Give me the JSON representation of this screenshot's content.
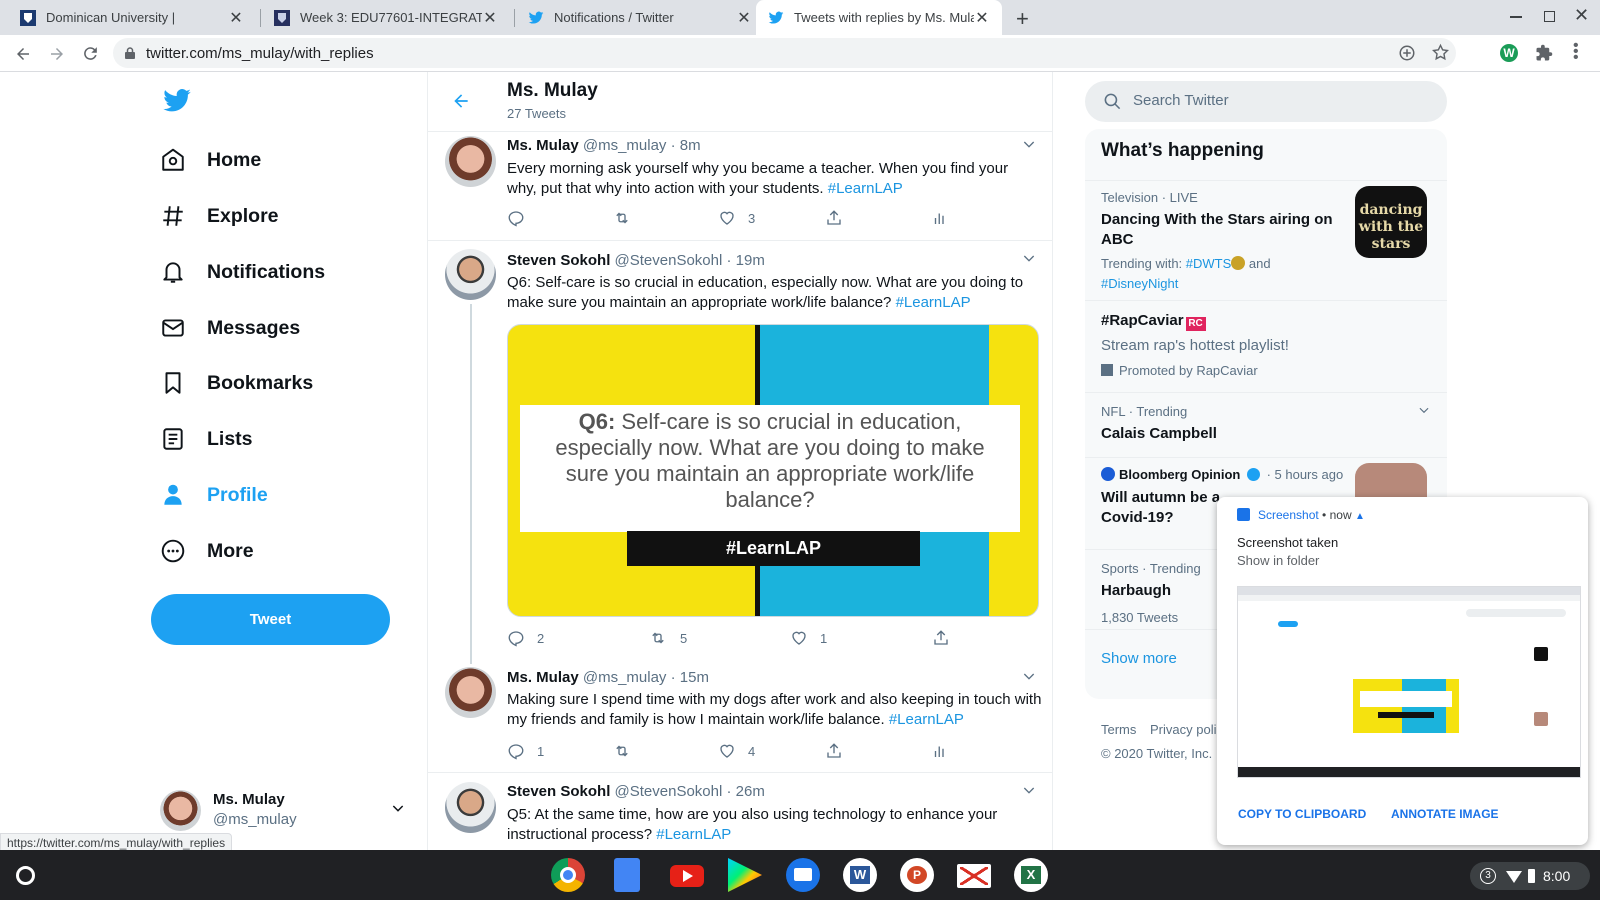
{
  "browser": {
    "tabs": [
      {
        "title": "Dominican University |"
      },
      {
        "title": "Week 3: EDU77601-INTEGRATIN"
      },
      {
        "title": "Notifications / Twitter"
      },
      {
        "title": "Tweets with replies by Ms. Mulay"
      }
    ],
    "url": "twitter.com/ms_mulay/with_replies",
    "status_url": "https://twitter.com/ms_mulay/with_replies"
  },
  "nav": {
    "items": [
      {
        "label": "Home"
      },
      {
        "label": "Explore"
      },
      {
        "label": "Notifications"
      },
      {
        "label": "Messages"
      },
      {
        "label": "Bookmarks"
      },
      {
        "label": "Lists"
      },
      {
        "label": "Profile"
      },
      {
        "label": "More"
      }
    ],
    "tweet_button": "Tweet",
    "account": {
      "name": "Ms. Mulay",
      "handle": "@ms_mulay"
    }
  },
  "header": {
    "title": "Ms. Mulay",
    "subtitle": "27 Tweets"
  },
  "tweets": [
    {
      "name": "Ms. Mulay",
      "handle": "@ms_mulay",
      "time": "· 8m",
      "text": "Every morning ask yourself why you became a teacher. When you find your why, put that why into action with your students.",
      "hashtag": "#LearnLAP",
      "replies": "",
      "retweets": "",
      "likes": "3"
    },
    {
      "name": "Steven Sokohl",
      "handle": "@StevenSokohl",
      "time": "· 19m",
      "text": "Q6: Self-care is so crucial in education, especially now. What are you doing to make sure you maintain an appropriate work/life balance?",
      "hashtag": "#LearnLAP",
      "image": {
        "q_label": "Q6:",
        "q_text": " Self-care is so crucial in education, especially now. What are you doing to make sure you maintain an appropriate work/life balance?",
        "tag": "#LearnLAP"
      },
      "replies": "2",
      "retweets": "5",
      "likes": "1"
    },
    {
      "name": "Ms. Mulay",
      "handle": "@ms_mulay",
      "time": "· 15m",
      "text": "Making sure I spend time with my dogs after work and also keeping in touch with my friends and family is how I maintain work/life balance.",
      "hashtag": "#LearnLAP",
      "replies": "1",
      "retweets": "",
      "likes": "4"
    },
    {
      "name": "Steven Sokohl",
      "handle": "@StevenSokohl",
      "time": "· 26m",
      "text": "Q5: At the same time, how are you also using technology to enhance your instructional process?",
      "hashtag": "#LearnLAP"
    }
  ],
  "sidebar": {
    "search_placeholder": "Search Twitter",
    "trends_title": "What’s happening",
    "trend1": {
      "meta": "Television · LIVE",
      "title": "Dancing With the Stars airing on ABC",
      "trending_with": "Trending with:",
      "tag1": "#DWTS",
      "and": "and",
      "tag2": "#DisneyNight",
      "thumb_text": "dancing with the stars"
    },
    "trend2": {
      "title": "#RapCaviar",
      "desc": "Stream rap's hottest playlist!",
      "promo": "Promoted by RapCaviar"
    },
    "trend3": {
      "meta": "NFL · Trending",
      "title": "Calais Campbell"
    },
    "trend4": {
      "source": "Bloomberg Opinion",
      "time": "· 5 hours ago",
      "title": "Will autumn be a",
      "title2": "Covid-19?"
    },
    "trend5": {
      "meta": "Sports · Trending",
      "title": "Harbaugh",
      "count": "1,830 Tweets"
    },
    "show_more": "Show more",
    "footer1": "Terms",
    "footer2": "Privacy poli",
    "footer3": "© 2020 Twitter, Inc."
  },
  "notification": {
    "app": "Screenshot",
    "time": "now",
    "title": "Screenshot taken",
    "subtitle": "Show in folder",
    "btn_copy": "COPY TO CLIPBOARD",
    "btn_annotate": "ANNOTATE IMAGE"
  },
  "shelf": {
    "badge": "3",
    "time": "8:00"
  },
  "colors": {
    "twitter_blue": "#1da1f2",
    "hashtag": "#1b95e0",
    "q6_yellow": "#f5e20f",
    "q6_cyan": "#1bb3dc"
  }
}
